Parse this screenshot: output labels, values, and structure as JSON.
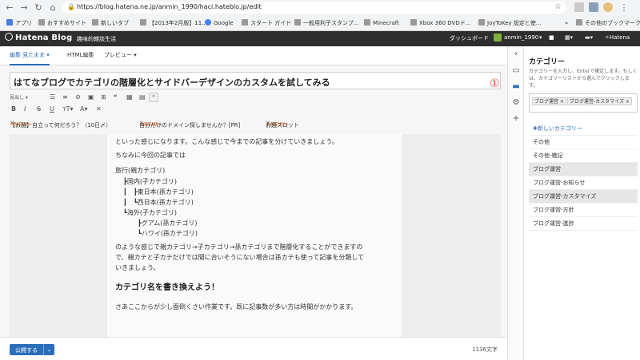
{
  "browser": {
    "url": "https://blog.hatena.ne.jp/anmin_1990/haci.hateblo.jp/edit",
    "bookmarks": [
      "アプリ",
      "おすすめサイト",
      "新しいタブ",
      "【2013年2月版】11...",
      "Google",
      "スタート ガイド",
      "一般用利子スタンプ...",
      "Minecraft",
      "Xbox 360 DVDド...",
      "JoyToKey 設定と使...",
      "»",
      "その他のブックマーク"
    ]
  },
  "header": {
    "logo": "Hatena Blog",
    "blog_name": "趣味的雑談生活",
    "dashboard": "ダッシュボード",
    "user": "anmin_1990",
    "hatena": "Hatena"
  },
  "editor": {
    "tabs": [
      "編集 見たまま",
      "HTML編集",
      "プレビュー"
    ],
    "title": "はてなブログでカテゴリの階層化とサイドバーデザインのカスタムを試してみる",
    "annotation": "①",
    "toolbar_format": "見出し",
    "notices": [
      {
        "new": "<NEW>",
        "text": "【お題】自立って何だろう？（10日〆）"
      },
      {
        "new": "<NEW>",
        "text": "自分だけのドメイン探しませんか？[PR]"
      },
      {
        "new": "<NEW>",
        "text": "お題スロット"
      }
    ],
    "body_lines": [
      "といった感じになります。こんな感じで今までの記事を分けていきましょう。",
      "ちなみに今回の記事では",
      "旅行(親カテゴリ)",
      "┣国内(子カテゴリ)",
      "┃　┣東日本(孫カテゴリ)",
      "┃　┗西日本(孫カテゴリ)",
      "┗海外(子カテゴリ)",
      "┣グアム(孫カテゴリ)",
      "┗ハワイ(孫カテゴリ)",
      "のような感じで親カテゴリ→子カテゴリ→孫カテゴリまで階層化することができますの",
      "で、親カテと子カテだけでは間に合いそうにない場合は孫カテも使って記事を分類して",
      "いきましょう。"
    ],
    "heading": "カテゴリ名を書き換えよう！",
    "after_heading": "さあここからが少し面倒くさい作業です。既に記事数が多い方は時間がかかります。",
    "publish": "公開する",
    "char_count": "1136文字"
  },
  "panel": {
    "title": "カテゴリー",
    "description": "カテゴリーを入力し、Enterで確定します。もしくは、カテゴリーリストから選んでクリックします。",
    "tags": [
      "ブログ運営",
      "ブログ運営-カスタマイズ"
    ],
    "new_category": "✚新しいカテゴリー",
    "categories": [
      "その他",
      "その他-雑記",
      "ブログ運営",
      "ブログ運営-お知らせ",
      "ブログ運営-カスタマイズ",
      "ブログ運営-方針",
      "ブログ運営-進捗"
    ]
  }
}
